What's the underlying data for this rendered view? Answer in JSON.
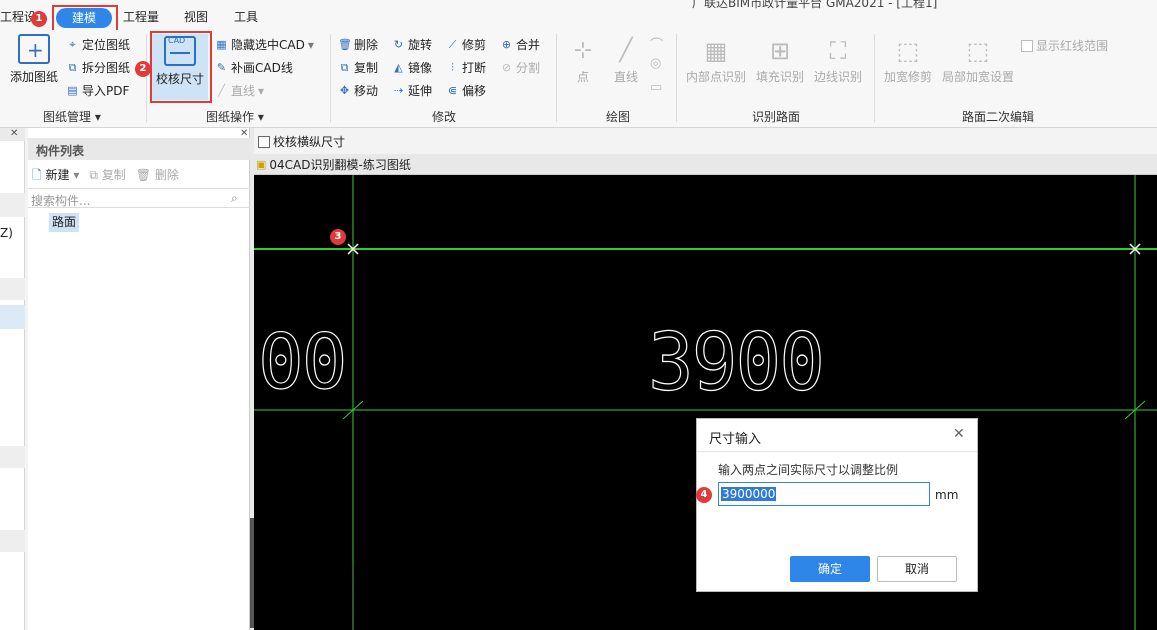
{
  "menubar": {
    "items": [
      "工程设",
      "建模",
      "工程量",
      "视图",
      "工具"
    ],
    "title_fragment": "广联达BIM市政计量平台 GMA2021 - [工程1]"
  },
  "ribbon": {
    "drawing_mgmt": {
      "add_drawing": "添加图纸",
      "locate": "定位图纸",
      "split": "拆分图纸",
      "import_pdf": "导入PDF",
      "label": "图纸管理"
    },
    "drawing_ops": {
      "check_size": "校核尺寸",
      "hide_cad": "隐藏选中CAD",
      "draw_cad_line": "补画CAD线",
      "line": "直线",
      "label": "图纸操作"
    },
    "modify": {
      "delete": "删除",
      "rotate": "旋转",
      "trim": "修剪",
      "merge": "合并",
      "copy": "复制",
      "mirror": "镜像",
      "break": "打断",
      "split": "分割",
      "move": "移动",
      "extend": "延伸",
      "offset": "偏移",
      "label": "修改"
    },
    "draw": {
      "point": "点",
      "line": "直线",
      "label": "绘图"
    },
    "identify_road": {
      "inner_point": "内部点识别",
      "fill": "填充识别",
      "edge": "边线识别",
      "label": "识别路面"
    },
    "road_edit": {
      "widen_trim": "加宽修剪",
      "local_widen": "局部加宽设置",
      "show_redline": "显示红线范围",
      "label": "路面二次编辑"
    }
  },
  "component_panel": {
    "title": "构件列表",
    "new": "新建",
    "copy": "复制",
    "delete": "删除",
    "search_placeholder": "搜索构件...",
    "items": [
      "路面"
    ]
  },
  "left_strip": {
    "fragment": "Z)"
  },
  "canvas": {
    "checkbox_label": "校核横纵尺寸",
    "tab_title": "04CAD识别翻模-练习图纸",
    "dimension_text": "3900",
    "partial_text": "00"
  },
  "dialog": {
    "title": "尺寸输入",
    "instruction": "输入两点之间实际尺寸以调整比例",
    "value": "3900000",
    "unit": "mm",
    "ok": "确定",
    "cancel": "取消"
  },
  "annotations": {
    "b1": "1",
    "b2": "2",
    "b3": "3",
    "b4": "4"
  },
  "colors": {
    "accent": "#2e86e8",
    "highlight_red": "#e03a3a",
    "cad_green": "#33cc33",
    "canvas_bg": "#000000"
  }
}
